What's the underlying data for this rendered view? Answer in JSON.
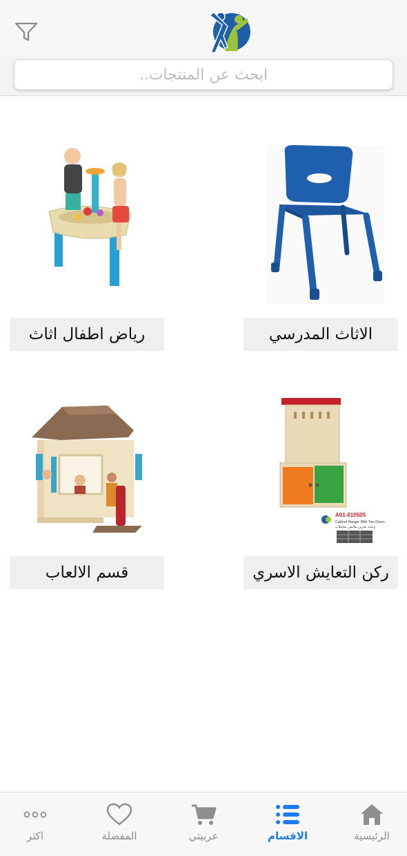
{
  "header": {
    "filter_icon": "filter-icon",
    "logo": "kids-logo"
  },
  "search": {
    "placeholder": "ابحث عن المنتجات.."
  },
  "categories": [
    {
      "label": "الاثاث المدرسي",
      "image": "blue-school-chair"
    },
    {
      "label": "رياض اطفال اثاث",
      "image": "kids-water-table"
    },
    {
      "label": "ركن التعايش الاسري",
      "image": "cabinet-hanger",
      "image_text": {
        "code": "A01-010505",
        "caption": "Cabinet Hanger With Two Doors",
        "caption_ar": "وحدة تخزين ملابس بحاملات"
      }
    },
    {
      "label": "قسم الالعاب",
      "image": "kids-playhouse"
    }
  ],
  "tabbar": {
    "items": [
      {
        "label": "الرئيسية",
        "icon": "home-icon",
        "active": false
      },
      {
        "label": "الاقسام",
        "icon": "list-icon",
        "active": true
      },
      {
        "label": "عربيتي",
        "icon": "cart-icon",
        "active": false
      },
      {
        "label": "المفضلة",
        "icon": "heart-icon",
        "active": false
      },
      {
        "label": "اكثر",
        "icon": "more-icon",
        "active": false
      }
    ]
  },
  "colors": {
    "accent": "#1d7cf2",
    "inactive": "#8e8e8e",
    "chair_blue": "#1e5fae",
    "logo_green": "#9cc43a",
    "logo_blue": "#1f5fa8"
  }
}
